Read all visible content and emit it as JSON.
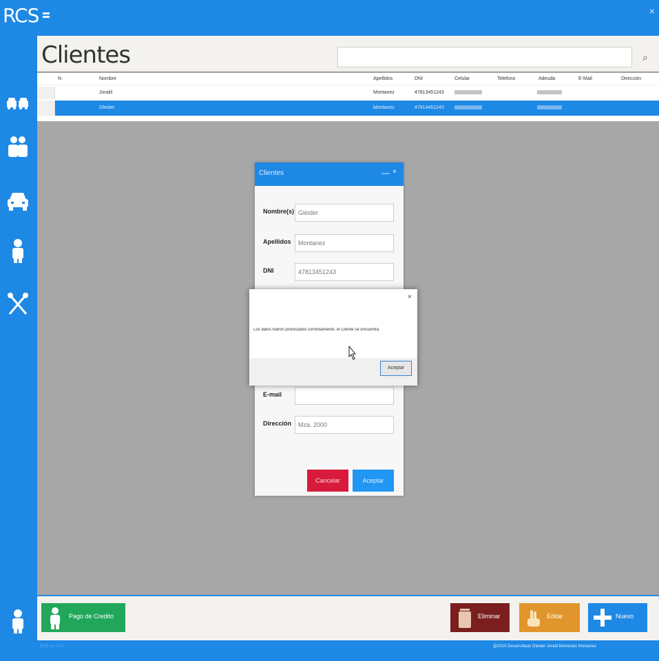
{
  "app": {
    "title": "RCS",
    "close_glyph": "×"
  },
  "page": {
    "title": "Clientes",
    "search_placeholder": ""
  },
  "grid": {
    "columns": [
      "N",
      "Nombre",
      "Apellidos",
      "DNI",
      "Celular",
      "Telefono",
      "Adeuda",
      "E-Mail",
      "Dirección"
    ],
    "rows": [
      {
        "n": "",
        "nombre": "Jorald",
        "apellidos": "Montanez",
        "dni": "47813451243"
      },
      {
        "n": "",
        "nombre": "Gleider",
        "apellidos": "Montanez",
        "dni": "47814451243"
      }
    ]
  },
  "dialog": {
    "title": "Clientes",
    "minimize_glyph": "—",
    "close_glyph": "×",
    "fields": [
      {
        "label": "Nombre(s)",
        "value": "Gleider"
      },
      {
        "label": "Apellidos",
        "value": "Montanez"
      },
      {
        "label": "DNI",
        "value": "47813451243"
      },
      {
        "label": "E-mail",
        "value": ""
      },
      {
        "label": "Dirección",
        "value": "Mza. 2000"
      }
    ],
    "cancel_label": "Cancelar",
    "accept_label": "Aceptar"
  },
  "msgbox": {
    "text": "Los datos fueron procesados correctamente, el Cliente se encuentra",
    "close_glyph": "×",
    "ok_label": "Aceptar"
  },
  "bottom": {
    "credit_label": "Pago de Credito",
    "delete_label": "Eliminar",
    "edit_label": "Editar",
    "new_label": "Nuevo"
  },
  "footer": {
    "left": "RCS v1.0.0.0",
    "right": "@2015 Desarrollado Gleider Jorald Montanez Montanez"
  },
  "colors": {
    "primary": "#1e88e5",
    "danger": "#d81b3c",
    "success": "#22a75a",
    "warning": "#e0962c",
    "dark_red": "#7a1e1e"
  },
  "icons": {
    "sidebar": [
      "cars-icon",
      "people-icon",
      "car-icon",
      "user-icon",
      "tools-icon",
      "user-profile-icon"
    ]
  }
}
